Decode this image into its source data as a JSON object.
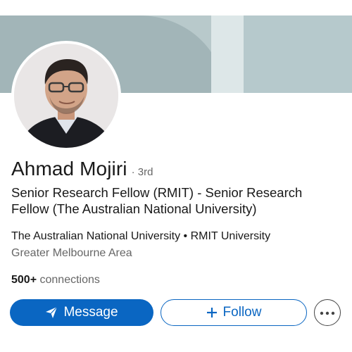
{
  "profile": {
    "name": "Ahmad Mojiri",
    "degree": "· 3rd",
    "headline": "Senior Research Fellow (RMIT) - Senior Research Fellow (The Australian National University)",
    "organizations": "The Australian National University • RMIT University",
    "location": "Greater Melbourne Area",
    "connections_count": "500+",
    "connections_label": " connections"
  },
  "actions": {
    "message_label": "Message",
    "follow_label": "Follow",
    "more_icon": "more-horizontal-icon"
  },
  "colors": {
    "accent": "#0a66c2",
    "text_primary": "#191919",
    "text_secondary": "#666666"
  }
}
